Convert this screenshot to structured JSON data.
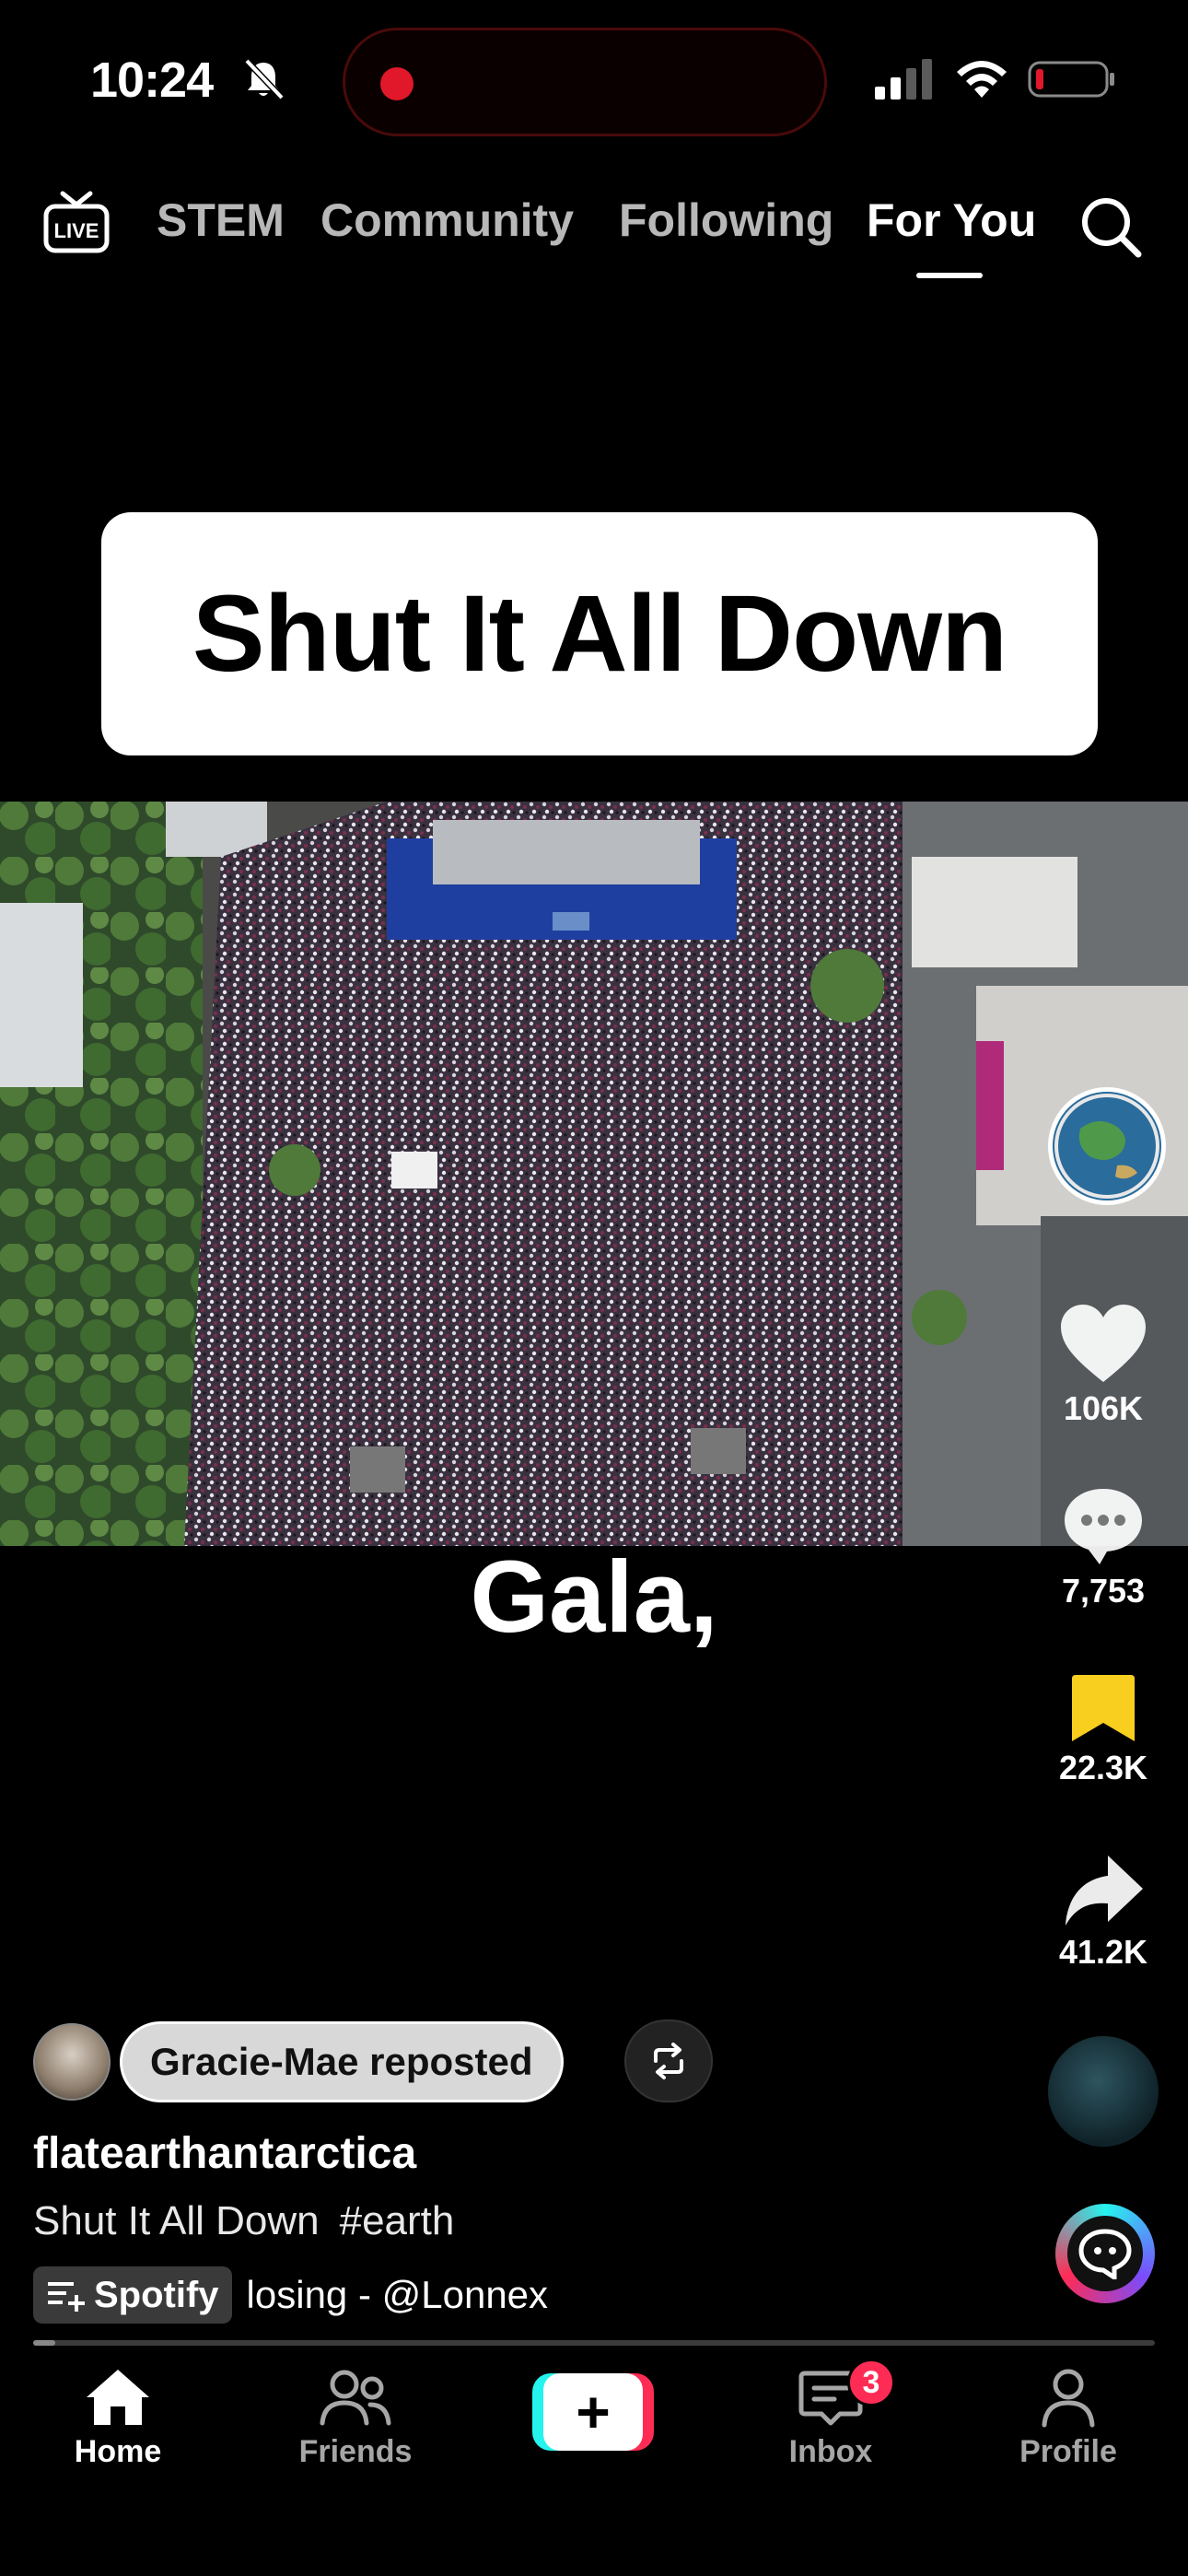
{
  "status_bar": {
    "time": "10:24"
  },
  "top_nav": {
    "live_label": "LIVE",
    "tabs": [
      {
        "label": "STEM"
      },
      {
        "label": "Community"
      },
      {
        "label": "Following"
      },
      {
        "label": "For You"
      }
    ],
    "active_tab": "For You"
  },
  "video": {
    "title_card": "Shut It All Down",
    "caption": "Gala,"
  },
  "actions": {
    "likes": "106K",
    "comments": "7,753",
    "saves": "22.3K",
    "shares": "41.2K"
  },
  "repost": {
    "label": "Gracie-Mae reposted"
  },
  "post": {
    "username": "flatearthantarctica",
    "description": "Shut It All Down",
    "hashtag": "#earth",
    "music_service": "Spotify",
    "music_title": "losing - @Lonnex",
    "progress": 0.02
  },
  "bottom_nav": {
    "items": [
      {
        "label": "Home"
      },
      {
        "label": "Friends"
      },
      {
        "label": "Inbox"
      },
      {
        "label": "Profile"
      }
    ],
    "inbox_badge": "3"
  },
  "colors": {
    "accent_red": "#fe2c55",
    "accent_cyan": "#25f4ee",
    "save_yellow": "#f8ce1f"
  }
}
